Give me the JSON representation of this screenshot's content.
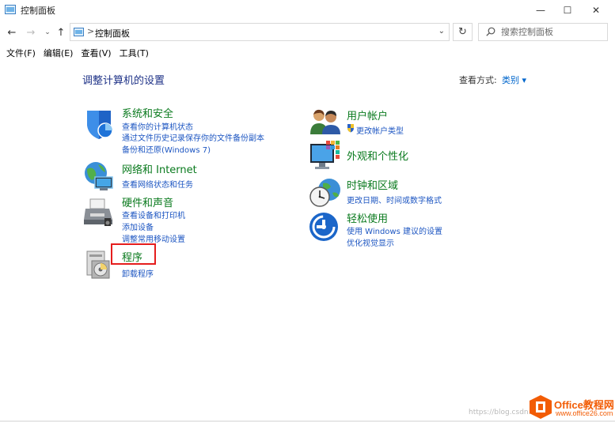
{
  "window": {
    "title": "控制面板",
    "min": "—",
    "max": "☐",
    "close": "✕"
  },
  "nav": {
    "back": "←",
    "forward": "→",
    "recent": "⌄",
    "up": "↑",
    "breadcrumb_sep": ">",
    "path": "控制面板",
    "refresh": "↻",
    "search_placeholder": "搜索控制面板"
  },
  "menubar": [
    "文件(F)",
    "编辑(E)",
    "查看(V)",
    "工具(T)"
  ],
  "page": {
    "title": "调整计算机的设置",
    "view_by_label": "查看方式:",
    "view_by_value": "类别 ▾"
  },
  "categories": {
    "system": {
      "title": "系统和安全",
      "icon": "shield-icon",
      "links": [
        "查看你的计算机状态",
        "通过文件历史记录保存你的文件备份副本",
        "备份和还原(Windows 7)"
      ]
    },
    "network": {
      "title": "网络和 Internet",
      "icon": "globe-network-icon",
      "links": [
        "查看网络状态和任务"
      ]
    },
    "hardware": {
      "title": "硬件和声音",
      "icon": "printer-icon",
      "links": [
        "查看设备和打印机",
        "添加设备",
        "调整常用移动设置"
      ]
    },
    "programs": {
      "title": "程序",
      "icon": "programs-icon",
      "links": [
        "卸载程序"
      ]
    },
    "users": {
      "title": "用户帐户",
      "icon": "users-icon",
      "links": [
        "更改帐户类型"
      ]
    },
    "appearance": {
      "title": "外观和个性化",
      "icon": "display-icon",
      "links": []
    },
    "clock": {
      "title": "时钟和区域",
      "icon": "clock-globe-icon",
      "links": [
        "更改日期、时间或数字格式"
      ]
    },
    "ease": {
      "title": "轻松使用",
      "icon": "ease-of-access-icon",
      "links": [
        "使用 Windows 建议的设置",
        "优化视觉显示"
      ]
    }
  },
  "watermark": {
    "url": "https://blog.csdn.n",
    "brand": "Office教程网",
    "site": "www.office26.com"
  },
  "colors": {
    "category_title": "#0a7a1e",
    "link": "#1d56c2",
    "page_title": "#1e3287",
    "highlight": "#e51d1d"
  }
}
